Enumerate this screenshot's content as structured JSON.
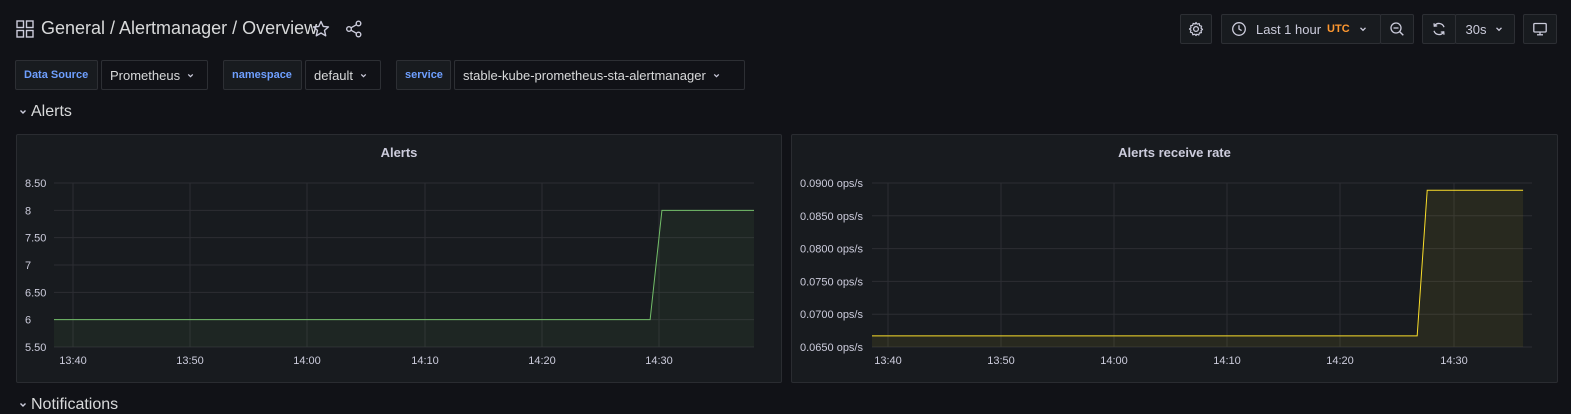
{
  "header": {
    "breadcrumb": "General / Alertmanager / Overview",
    "time_range": "Last 1 hour",
    "timezone": "UTC",
    "refresh": "30s"
  },
  "variables": [
    {
      "label": "Data Source",
      "value": "Prometheus"
    },
    {
      "label": "namespace",
      "value": "default"
    },
    {
      "label": "service",
      "value": "stable-kube-prometheus-sta-alertmanager"
    }
  ],
  "rows": {
    "alerts": "Alerts",
    "notifications": "Notifications"
  },
  "chart_data": [
    {
      "type": "area",
      "title": "Alerts",
      "x_ticks": [
        "13:40",
        "13:50",
        "14:00",
        "14:10",
        "14:20",
        "14:30"
      ],
      "y_ticks": [
        "5.50",
        "6",
        "6.50",
        "7",
        "7.50",
        "8",
        "8.50"
      ],
      "ylim": [
        5.5,
        8.5
      ],
      "xlim_minutes": [
        -1,
        58.3
      ],
      "grid": true,
      "color": "#73bf69",
      "series": [
        {
          "x_minutes": [
            -1,
            49.5,
            50.5,
            58.3
          ],
          "values": [
            6,
            6,
            8,
            8
          ]
        }
      ]
    },
    {
      "type": "area",
      "title": "Alerts receive rate",
      "x_ticks": [
        "13:40",
        "13:50",
        "14:00",
        "14:10",
        "14:20",
        "14:30"
      ],
      "y_ticks": [
        "0.0650 ops/s",
        "0.0700 ops/s",
        "0.0750 ops/s",
        "0.0800 ops/s",
        "0.0850 ops/s",
        "0.0900 ops/s"
      ],
      "ylim": [
        0.065,
        0.09
      ],
      "xlim_minutes": [
        -0.2,
        59
      ],
      "grid": true,
      "color": "#fade2a",
      "series": [
        {
          "x_minutes": [
            -0.2,
            48.7,
            49.6,
            58.2
          ],
          "values": [
            0.0667,
            0.0667,
            0.0889,
            0.0889
          ]
        }
      ]
    }
  ]
}
